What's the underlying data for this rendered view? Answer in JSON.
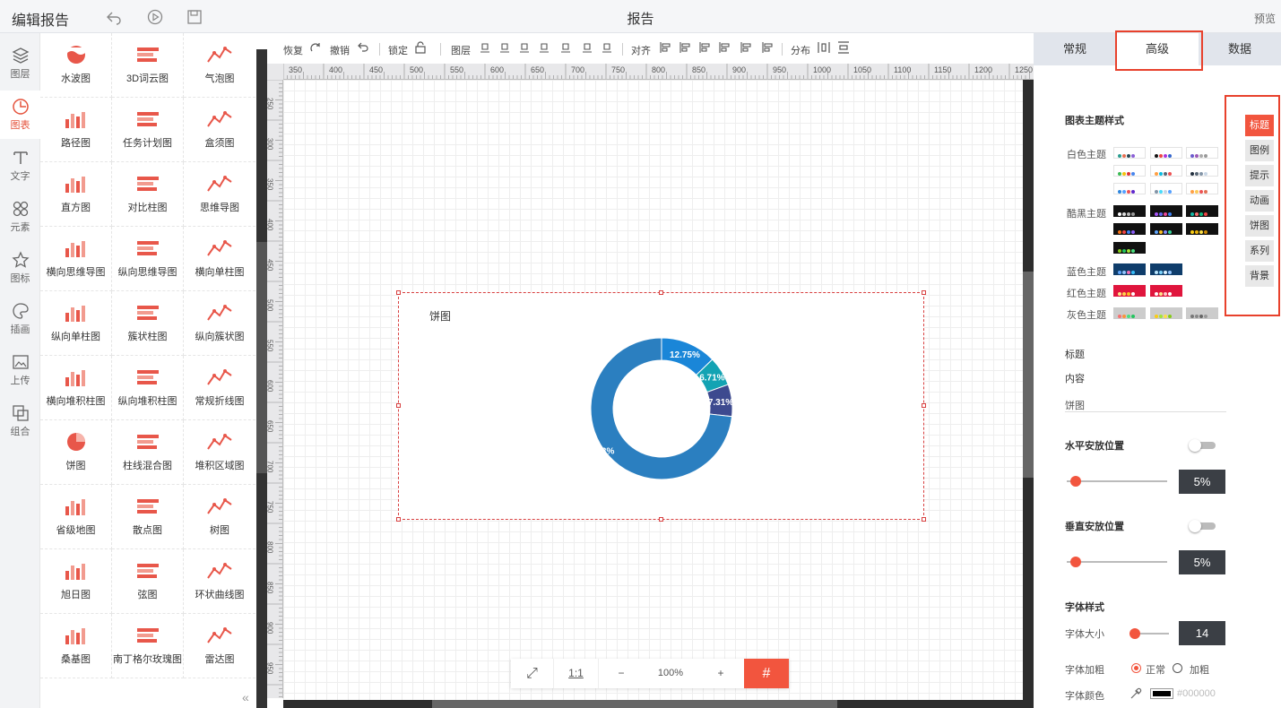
{
  "app_title": "编辑报告",
  "page_title": "报告",
  "preview": "预览",
  "left_nav": [
    {
      "label": "图层",
      "icon": "layers-icon"
    },
    {
      "label": "图表",
      "icon": "chart-clock-icon"
    },
    {
      "label": "文字",
      "icon": "text-icon"
    },
    {
      "label": "元素",
      "icon": "elements-icon"
    },
    {
      "label": "图标",
      "icon": "star-icon"
    },
    {
      "label": "插画",
      "icon": "palette-icon"
    },
    {
      "label": "上传",
      "icon": "upload-image-icon"
    },
    {
      "label": "组合",
      "icon": "group-icon"
    }
  ],
  "library": [
    "水波图",
    "3D词云图",
    "气泡图",
    "路径图",
    "任务计划图",
    "盒须图",
    "直方图",
    "对比柱图",
    "思维导图",
    "横向思维导图",
    "纵向思维导图",
    "横向单柱图",
    "纵向单柱图",
    "簇状柱图",
    "纵向簇状图",
    "横向堆积柱图",
    "纵向堆积柱图",
    "常规折线图",
    "饼图",
    "柱线混合图",
    "堆积区域图",
    "省级地图",
    "散点图",
    "树图",
    "旭日图",
    "弦图",
    "环状曲线图",
    "桑基图",
    "南丁格尔玫瑰图",
    "雷达图"
  ],
  "toolbar": {
    "redo": "恢复",
    "undo": "撤销",
    "lock": "锁定",
    "layer": "图层",
    "align": "对齐",
    "distribute": "分布"
  },
  "ruler_x": [
    "350",
    "400",
    "450",
    "500",
    "550",
    "600",
    "650",
    "700",
    "750",
    "800",
    "850",
    "900",
    "950",
    "1000",
    "1050",
    "1100",
    "1150",
    "1200",
    "1250"
  ],
  "ruler_y": [
    "250",
    "300",
    "350",
    "400",
    "450",
    "500",
    "550",
    "600",
    "650",
    "700",
    "750",
    "800",
    "850",
    "900",
    "950"
  ],
  "chart": {
    "title": "饼图"
  },
  "chart_data": {
    "type": "pie",
    "donut": true,
    "values": [
      12.75,
      6.71,
      7.31,
      73.23
    ],
    "labels": [
      "12.75%",
      "6.71%",
      "7.31%",
      "73.23%"
    ],
    "colors": [
      "#1a86d8",
      "#13a3b3",
      "#3d4a8f",
      "#2b7fc0"
    ]
  },
  "zoom": {
    "fit": "⤢",
    "one": "1:1",
    "minus": "−",
    "value": "100%",
    "plus": "+",
    "grid": "#"
  },
  "tabs": [
    "常规",
    "高级",
    "数据"
  ],
  "active_tab": "高级",
  "right": {
    "theme_section": "图表主题样式",
    "white": "白色主题",
    "dark": "酷黑主题",
    "blue": "蓝色主题",
    "red": "红色主题",
    "grey": "灰色主题",
    "title_label": "标题",
    "content_label": "内容",
    "content_value": "饼图",
    "hpos": "水平安放位置",
    "hval": "5%",
    "vpos": "垂直安放位置",
    "vval": "5%",
    "font_section": "字体样式",
    "font_size": "字体大小",
    "font_size_val": "14",
    "font_weight": "字体加粗",
    "normal": "正常",
    "bold": "加粗",
    "font_color": "字体颜色",
    "font_color_val": "#000000"
  },
  "side_tabs": [
    "标题",
    "图例",
    "提示",
    "动画",
    "饼图",
    "系列",
    "背景"
  ]
}
